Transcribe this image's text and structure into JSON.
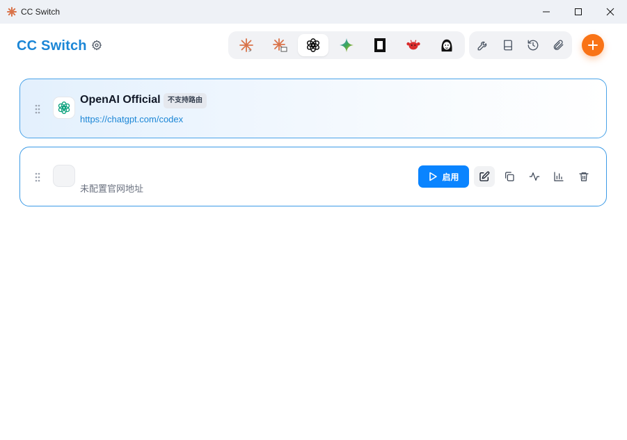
{
  "window": {
    "title": "CC Switch"
  },
  "header": {
    "brand": "CC Switch",
    "app_tabs": [
      {
        "icon": "claude-icon"
      },
      {
        "icon": "claude-desktop-icon"
      },
      {
        "icon": "openai-icon",
        "active": true
      },
      {
        "icon": "gemini-icon"
      },
      {
        "icon": "opencode-icon"
      },
      {
        "icon": "red-crab-icon"
      },
      {
        "icon": "cartoon-face-icon"
      }
    ],
    "tools": [
      {
        "icon": "wrench-icon"
      },
      {
        "icon": "book-icon"
      },
      {
        "icon": "history-icon"
      },
      {
        "icon": "paperclip-icon"
      }
    ],
    "accent_color": "#f97316"
  },
  "providers": [
    {
      "name": "OpenAI Official",
      "badge": "不支持路由",
      "url": "https://chatgpt.com/codex",
      "icon": "openai-icon",
      "active": true
    },
    {
      "name": "",
      "url": "未配置官网地址",
      "icon": "blank-provider-icon",
      "enable_label": "启用",
      "actions": [
        "edit-icon",
        "duplicate-icon",
        "activity-icon",
        "bar-chart-icon",
        "trash-icon"
      ]
    }
  ],
  "colors": {
    "brand": "#1b86d6",
    "primary_button": "#0a84ff",
    "card_border": "#4aa3e8"
  }
}
